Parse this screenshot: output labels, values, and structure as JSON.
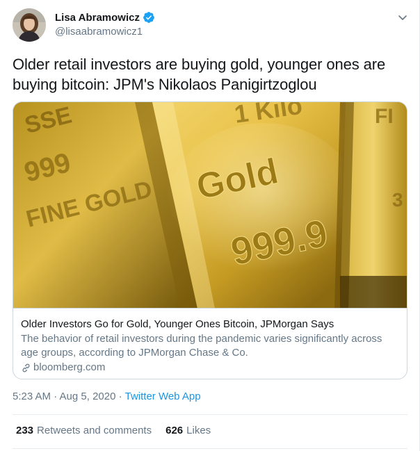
{
  "author": {
    "display_name": "Lisa Abramowicz",
    "handle": "@lisaabramowicz1",
    "verified": true
  },
  "icons": {
    "verified": "verified-badge-icon",
    "caret": "chevron-down-icon",
    "link": "link-icon"
  },
  "colors": {
    "verified": "#1da1f2",
    "link": "#1b95e0",
    "secondary_text": "#657786"
  },
  "tweet": {
    "text": "Older retail investors are buying gold, younger ones are buying bitcoin: JPM's Nikolaos Panigirtzoglou"
  },
  "card": {
    "title": "Older Investors Go for Gold, Younger Ones Bitcoin, JPMorgan Says",
    "description": "The behavior of retail investors during the pandemic varies significantly across age groups, according to JPMorgan Chase & Co.",
    "domain": "bloomberg.com",
    "image_stamps": {
      "left_top": "SSE",
      "left_mid": "999",
      "left_gold": "FINE GOLD",
      "main_kilo": "1 Kilo",
      "main_gold": "Gold",
      "main_fine": "999.9",
      "right_top": "FI",
      "right_mid": "3"
    }
  },
  "meta": {
    "timestamp": "5:23 AM · Aug 5, 2020 ·",
    "source": "Twitter Web App"
  },
  "stats": {
    "retweets_count": "233",
    "retweets_label": "Retweets and comments",
    "likes_count": "626",
    "likes_label": "Likes"
  }
}
